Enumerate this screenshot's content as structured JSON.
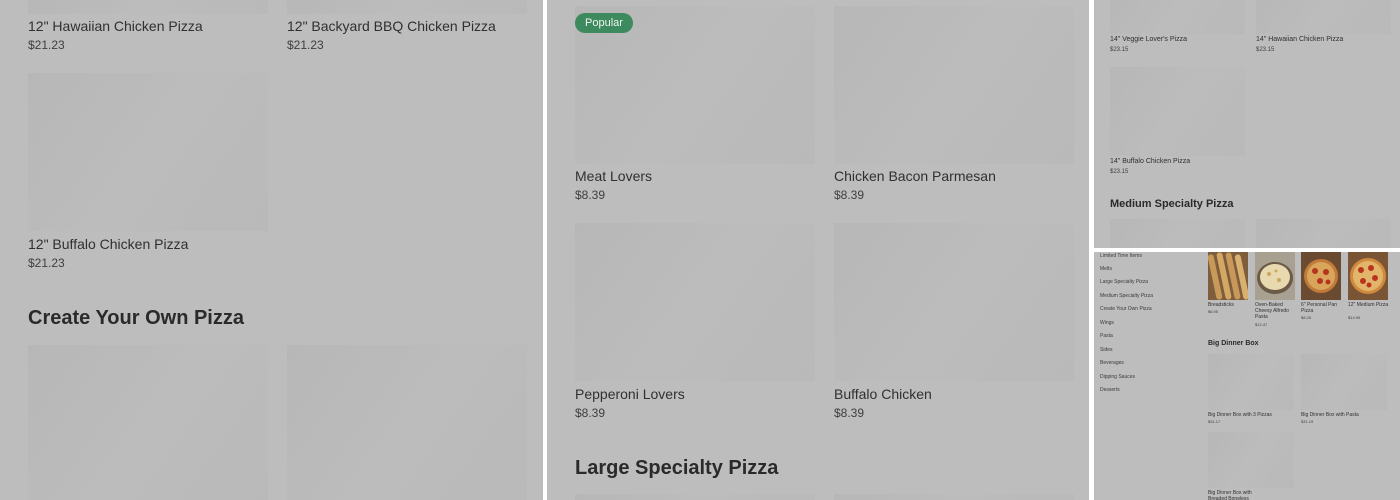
{
  "panel1": {
    "row1": [
      {
        "name": "12\" Hawaiian Chicken Pizza",
        "price": "$21.23"
      },
      {
        "name": "12\" Backyard BBQ Chicken Pizza",
        "price": "$21.23"
      }
    ],
    "row2": [
      {
        "name": "12\" Buffalo Chicken Pizza",
        "price": "$21.23"
      }
    ],
    "section_heading": "Create Your Own Pizza"
  },
  "panel2": {
    "badge": "Popular",
    "row1": [
      {
        "name": "Meat Lovers",
        "price": "$8.39"
      },
      {
        "name": "Chicken Bacon Parmesan",
        "price": "$8.39"
      }
    ],
    "row2": [
      {
        "name": "Pepperoni Lovers",
        "price": "$8.39"
      },
      {
        "name": "Buffalo Chicken",
        "price": "$8.39"
      }
    ],
    "section_heading": "Large Specialty Pizza"
  },
  "panel3": {
    "row1": [
      {
        "name": "14\" Veggie Lover's Pizza",
        "price": "$23.15"
      },
      {
        "name": "14\" Hawaiian Chicken Pizza",
        "price": "$23.15"
      }
    ],
    "row2": [
      {
        "name": "14\" Buffalo Chicken Pizza",
        "price": "$23.15"
      }
    ],
    "section_heading": "Medium Specialty Pizza"
  },
  "panel4": {
    "sidebar": [
      "Limited Time Items",
      "Melts",
      "Large Specialty Pizza",
      "Medium Specialty Pizza",
      "Create Your Own Pizza",
      "Wings",
      "Pasta",
      "Sides",
      "Beverages",
      "Dipping Sauces",
      "Desserts"
    ],
    "top_items": [
      {
        "name": "Breadsticks",
        "price": "$6.95",
        "icon": "breadsticks-image"
      },
      {
        "name": "Oven-Baked Cheesy Alfredo Pasta",
        "price": "$12.47",
        "icon": "pasta-image"
      },
      {
        "name": "6\" Personal Pan Pizza",
        "price": "$8.25",
        "icon": "pan-pizza-image"
      },
      {
        "name": "12\" Medium Pizza",
        "price": "$14.99",
        "icon": "medium-pizza-image"
      }
    ],
    "section_heading": "Big Dinner Box",
    "box_items": [
      {
        "name": "Big Dinner Box with 3 Pizzas",
        "price": "$31.17"
      },
      {
        "name": "Big Dinner Box with Pasta",
        "price": "$31.19"
      },
      {
        "name": "Big Dinner Box with Breaded Boneless Wings"
      }
    ]
  },
  "colors": {
    "overlay": "#bdbdbd",
    "badge": "#3e8a5f",
    "divider": "#ffffff"
  }
}
